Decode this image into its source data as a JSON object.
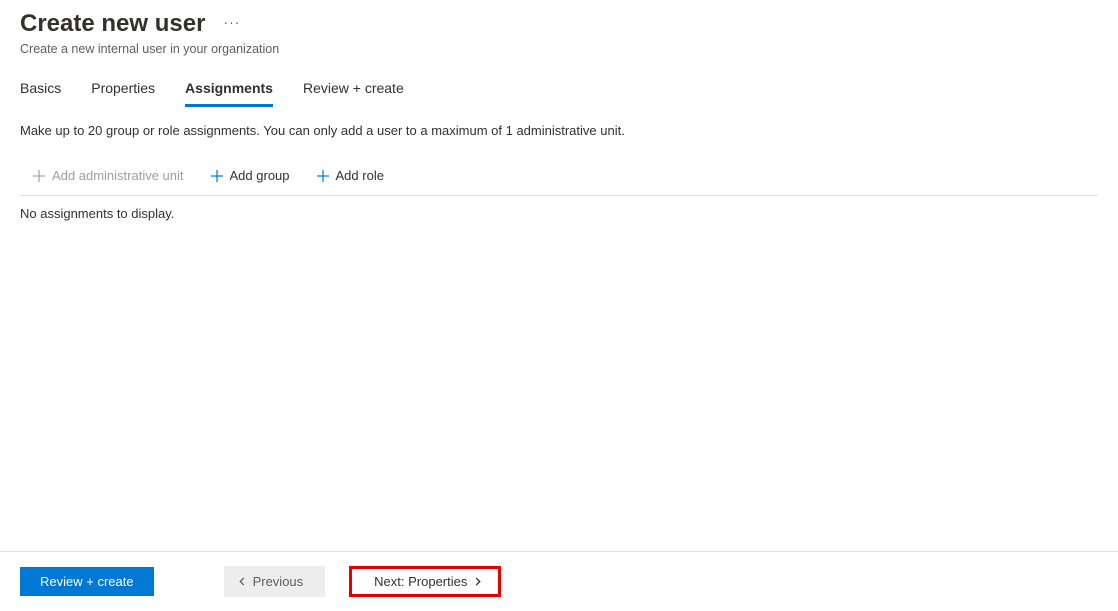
{
  "header": {
    "title": "Create new user",
    "subtitle": "Create a new internal user in your organization"
  },
  "tabs": {
    "items": [
      {
        "label": "Basics",
        "active": false
      },
      {
        "label": "Properties",
        "active": false
      },
      {
        "label": "Assignments",
        "active": true
      },
      {
        "label": "Review + create",
        "active": false
      }
    ]
  },
  "content": {
    "info": "Make up to 20 group or role assignments. You can only add a user to a maximum of 1 administrative unit.",
    "actions": {
      "add_admin_unit": "Add administrative unit",
      "add_group": "Add group",
      "add_role": "Add role"
    },
    "empty_message": "No assignments to display."
  },
  "footer": {
    "review_create": "Review + create",
    "previous": "Previous",
    "next": "Next: Properties"
  }
}
